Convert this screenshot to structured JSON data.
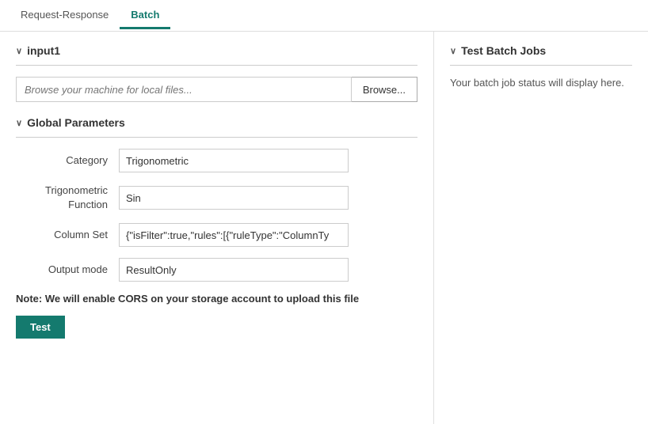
{
  "tabs": [
    {
      "id": "request-response",
      "label": "Request-Response",
      "active": false
    },
    {
      "id": "batch",
      "label": "Batch",
      "active": true
    }
  ],
  "left": {
    "input_section": {
      "header": "input1",
      "browse_placeholder": "Browse your machine for local files...",
      "browse_button_label": "Browse..."
    },
    "global_params_section": {
      "header": "Global Parameters",
      "params": [
        {
          "id": "category",
          "label": "Category",
          "value": "Trigonometric"
        },
        {
          "id": "trigonometric-function",
          "label": "Trigonometric\nFunction",
          "value": "Sin"
        },
        {
          "id": "column-set",
          "label": "Column Set",
          "value": "{\"isFilter\":true,\"rules\":[{\"ruleType\":\"ColumnTy"
        },
        {
          "id": "output-mode",
          "label": "Output mode",
          "value": "ResultOnly"
        }
      ]
    },
    "note": "Note: We will enable CORS on your storage account to upload this file",
    "test_button_label": "Test"
  },
  "right": {
    "header": "Test Batch Jobs",
    "status_text": "Your batch job status will display here."
  }
}
